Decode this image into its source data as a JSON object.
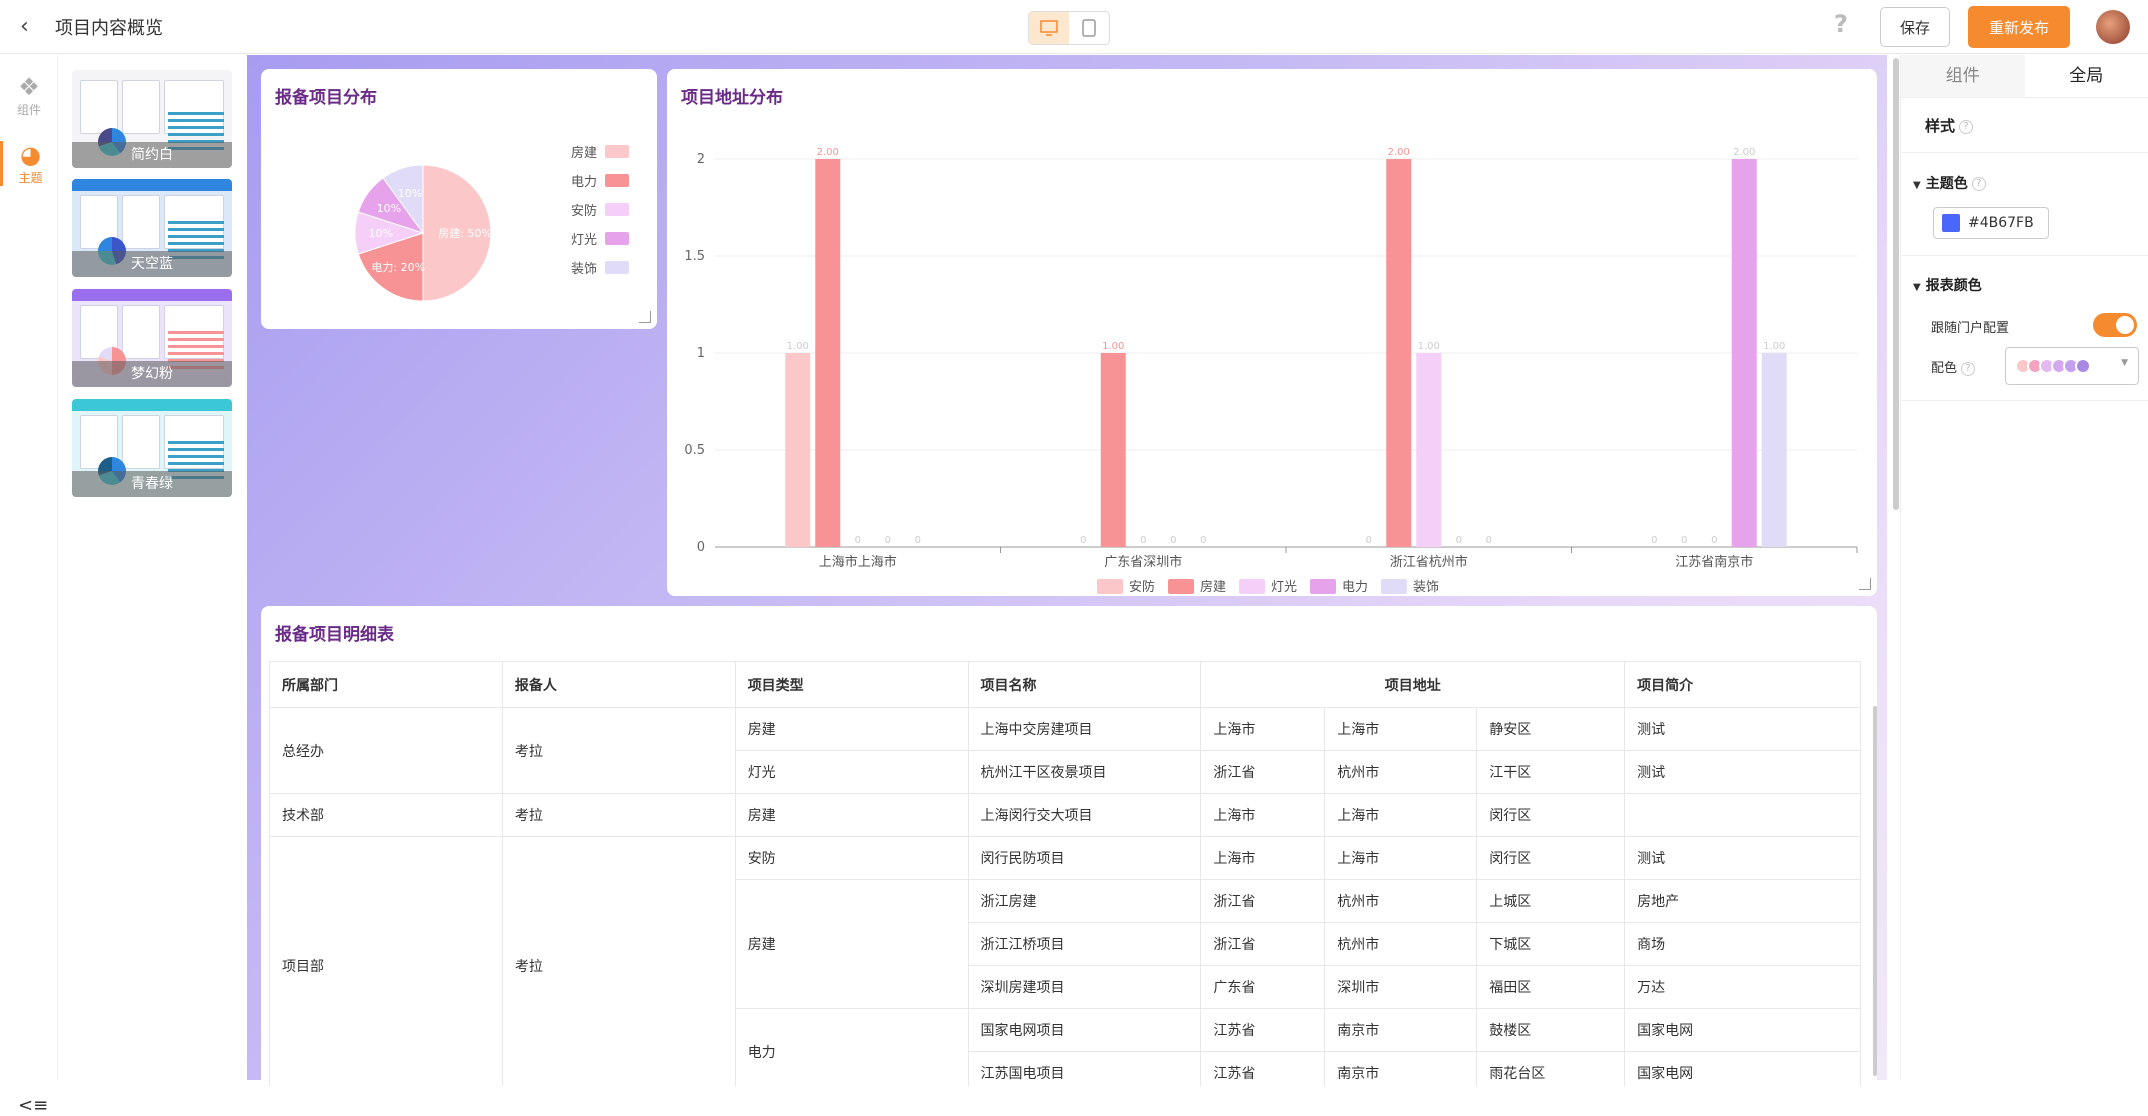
{
  "header": {
    "title": "项目内容概览",
    "save_label": "保存",
    "publish_label": "重新发布",
    "help": "?"
  },
  "rail": {
    "components_label": "组件",
    "theme_label": "主题"
  },
  "themes": [
    {
      "name": "简约白",
      "accent": "#f68a2f"
    },
    {
      "name": "天空蓝",
      "accent": "#2e86de"
    },
    {
      "name": "梦幻粉",
      "accent": "#9b6ef0"
    },
    {
      "name": "青春绿",
      "accent": "#3cc7d6"
    }
  ],
  "pie_card": {
    "title": "报备项目分布"
  },
  "bar_card": {
    "title": "项目地址分布"
  },
  "table_card": {
    "title": "报备项目明细表"
  },
  "chart_data": [
    {
      "type": "pie",
      "title": "报备项目分布",
      "slices": [
        {
          "name": "房建",
          "value": 50,
          "label": "房建: 50%",
          "color": "#fcc7c8"
        },
        {
          "name": "电力",
          "value": 20,
          "label": "电力: 20%",
          "color": "#f89395"
        },
        {
          "name": "安防",
          "value": 10,
          "label": "10%",
          "color": "#f5cff8"
        },
        {
          "name": "灯光",
          "value": 10,
          "label": "10%",
          "color": "#e6a3ec"
        },
        {
          "name": "装饰",
          "value": 10,
          "label": "10%",
          "color": "#e0dcf8"
        }
      ],
      "legend": [
        "房建",
        "电力",
        "安防",
        "灯光",
        "装饰"
      ]
    },
    {
      "type": "bar",
      "title": "项目地址分布",
      "categories": [
        "上海市上海市",
        "广东省深圳市",
        "浙江省杭州市",
        "江苏省南京市"
      ],
      "ylim": [
        0,
        2
      ],
      "yticks": [
        "0",
        "0.5",
        "1",
        "1.5",
        "2"
      ],
      "series": [
        {
          "name": "安防",
          "color": "#fcc7c8",
          "values": [
            1,
            0,
            0,
            0
          ],
          "labels": [
            "1.00",
            "0",
            "0",
            "0"
          ]
        },
        {
          "name": "房建",
          "color": "#f89395",
          "values": [
            2,
            1,
            2,
            0
          ],
          "labels": [
            "2.00",
            "1.00",
            "2.00",
            "0"
          ]
        },
        {
          "name": "灯光",
          "color": "#f5cff8",
          "values": [
            0,
            0,
            1,
            0
          ],
          "labels": [
            "0",
            "0",
            "1.00",
            "0"
          ]
        },
        {
          "name": "电力",
          "color": "#e6a3ec",
          "values": [
            0,
            0,
            0,
            2
          ],
          "labels": [
            "0",
            "0",
            "0",
            "2.00"
          ]
        },
        {
          "name": "装饰",
          "color": "#e0dcf8",
          "values": [
            0,
            0,
            0,
            1
          ],
          "labels": [
            "0",
            "0",
            "0",
            "1.00"
          ]
        }
      ]
    }
  ],
  "table": {
    "headers": [
      "所属部门",
      "报备人",
      "项目类型",
      "项目名称",
      "项目地址",
      "项目简介"
    ],
    "rows": [
      [
        "上海中交房建项目",
        "上海市",
        "上海市",
        "静安区",
        "测试"
      ],
      [
        "杭州江干区夜景项目",
        "浙江省",
        "杭州市",
        "江干区",
        "测试"
      ],
      [
        "上海闵行交大项目",
        "上海市",
        "上海市",
        "闵行区",
        ""
      ],
      [
        "闵行民防项目",
        "上海市",
        "上海市",
        "闵行区",
        "测试"
      ],
      [
        "浙江房建",
        "浙江省",
        "杭州市",
        "上城区",
        "房地产"
      ],
      [
        "浙江江桥项目",
        "浙江省",
        "杭州市",
        "下城区",
        "商场"
      ],
      [
        "深圳房建项目",
        "广东省",
        "深圳市",
        "福田区",
        "万达"
      ],
      [
        "国家电网项目",
        "江苏省",
        "南京市",
        "鼓楼区",
        "国家电网"
      ],
      [
        "江苏国电项目",
        "江苏省",
        "南京市",
        "雨花台区",
        "国家电网"
      ]
    ],
    "groups": {
      "dept": [
        "总经办",
        "技术部",
        "项目部"
      ],
      "person": [
        "考拉",
        "考拉",
        "考拉"
      ],
      "types": [
        "房建",
        "灯光",
        "房建",
        "安防",
        "房建",
        "电力"
      ]
    }
  },
  "panel": {
    "tab_components": "组件",
    "tab_global": "全局",
    "style_label": "样式",
    "theme_color_label": "主题色",
    "theme_color": "#4B67FB",
    "chart_color_label": "报表颜色",
    "follow_portal_label": "跟随门户配置",
    "follow_portal": true,
    "palette_label": "配色",
    "palette": [
      "#fcc7c8",
      "#f5a3c0",
      "#e6b8f0",
      "#d5a9ef",
      "#c4a0ee",
      "#a989e6"
    ]
  }
}
